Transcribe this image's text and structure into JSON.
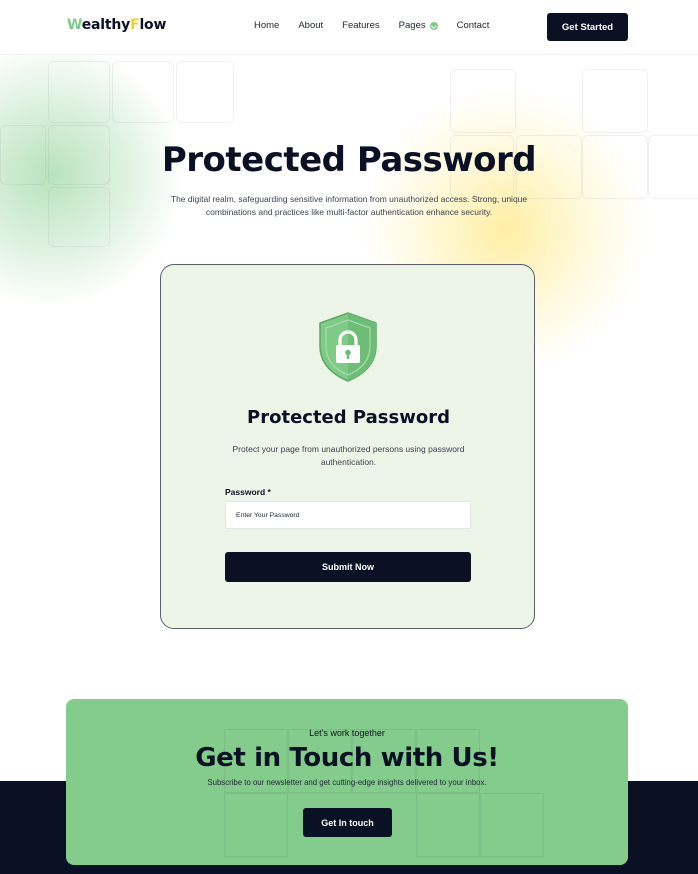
{
  "brand": {
    "logo_first": "W",
    "logo_middle": "ealthy",
    "logo_f": "F",
    "logo_rest": "low",
    "colors": {
      "green": "#7fcb86",
      "yellow": "#f1d01b",
      "dark": "#0b1124",
      "card_bg": "#edf5e8",
      "cta_bg": "#84cc8c"
    }
  },
  "nav": {
    "items": [
      {
        "label": "Home"
      },
      {
        "label": "About"
      },
      {
        "label": "Features"
      },
      {
        "label": "Pages",
        "icon": "chevron-badge-icon"
      },
      {
        "label": "Contact"
      }
    ],
    "cta_label": "Get Started"
  },
  "hero": {
    "title": "Protected Password",
    "subtitle": "The digital realm, safeguarding sensitive information from unauthorized access. Strong, unique combinations and practices like multi-factor authentication enhance security."
  },
  "card": {
    "icon": "shield-lock-icon",
    "title": "Protected Password",
    "description": "Protect your page from unauthorized persons using password authentication.",
    "field_label": "Password *",
    "field_placeholder": "Enter Your Password",
    "field_value": "",
    "submit_label": "Submit Now"
  },
  "cta": {
    "kicker": "Let's work together",
    "title": "Get in Touch with Us!",
    "subtitle": "Subscribe to our newsletter and get cutting-edge insights delivered to your inbox.",
    "button_label": "Get In touch"
  }
}
